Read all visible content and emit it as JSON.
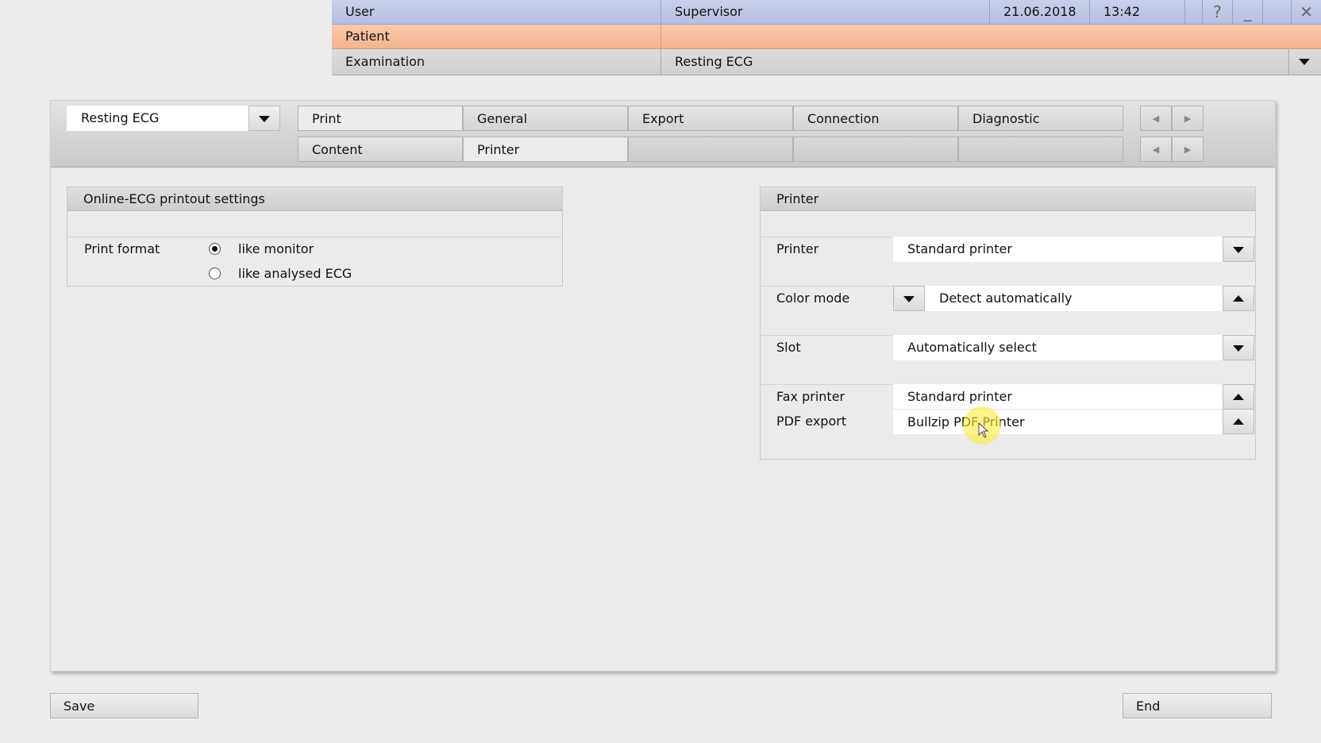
{
  "header": {
    "user_label": "User",
    "user_value": "Supervisor",
    "date": "21.06.2018",
    "time": "13:42",
    "help_glyph": "?",
    "minimize_glyph": "_",
    "close_glyph": "✕",
    "patient_label": "Patient",
    "exam_label": "Examination",
    "exam_value": "Resting ECG"
  },
  "toolbar": {
    "mode_value": "Resting ECG",
    "tabs_row1": [
      "Print",
      "General",
      "Export",
      "Connection",
      "Diagnostic"
    ],
    "tabs_row2": [
      "Content",
      "Printer"
    ],
    "nav_left": "◀",
    "nav_right": "▶"
  },
  "left_group": {
    "title": "Online-ECG printout settings",
    "print_format_label": "Print format",
    "options": [
      "like monitor",
      "like analysed ECG"
    ],
    "selected": 0
  },
  "printer_group": {
    "title": "Printer",
    "printer_label": "Printer",
    "printer_value": "Standard printer",
    "color_mode_label": "Color mode",
    "color_mode_value": "Detect automatically",
    "slot_label": "Slot",
    "slot_value": "Automatically select",
    "fax_label": "Fax printer",
    "fax_value": "Standard printer",
    "pdf_label": "PDF export",
    "pdf_value": "Bullzip PDF Printer"
  },
  "footer": {
    "save_label": "Save",
    "end_label": "End"
  },
  "colors": {
    "user_row": "#bcc4e4",
    "patient_row": "#f6bc9a",
    "cursor_highlight": "#fff03c"
  },
  "icons": {
    "dropdown": "chevron-down-icon",
    "dropup": "chevron-up-icon",
    "nav_prev": "arrow-left-icon",
    "nav_next": "arrow-right-icon",
    "help": "help-icon",
    "minimize": "minimize-icon",
    "close": "close-icon"
  }
}
